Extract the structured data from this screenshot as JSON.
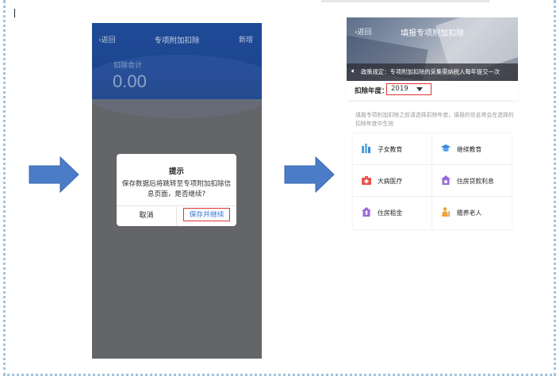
{
  "left_phone": {
    "back_label": "返回",
    "title": "专项附加扣除",
    "new_label": "新增",
    "sum_label": "扣除合计",
    "sum_value": "0.00"
  },
  "dialog": {
    "title": "提示",
    "message": "保存数据后将跳转至专项附加扣除信息页面，是否继续?",
    "cancel_label": "取消",
    "confirm_label": "保存并继续"
  },
  "right_phone": {
    "back_label": "返回",
    "title": "填报专项附加扣除",
    "notice_text": "政策规定：专项附加扣除的采集需纳税人每年提交一次",
    "year_label": "扣除年度：",
    "year_value": "2019",
    "hint": "填报专项附加扣除之前请选择扣除年度，填报的信息将会在选择的扣除年度中生效",
    "items": [
      {
        "label": "子女教育",
        "icon": "children-education-icon",
        "color": "#4a9ee0"
      },
      {
        "label": "继续教育",
        "icon": "graduation-cap-icon",
        "color": "#3b8de0"
      },
      {
        "label": "大病医疗",
        "icon": "medical-kit-icon",
        "color": "#e8564a"
      },
      {
        "label": "住房贷款利息",
        "icon": "house-loan-icon",
        "color": "#9b6ad9"
      },
      {
        "label": "住房租金",
        "icon": "house-rent-icon",
        "color": "#9b6ad9"
      },
      {
        "label": "赡养老人",
        "icon": "elderly-care-icon",
        "color": "#f2a33a"
      }
    ]
  },
  "colors": {
    "header_blue": "#1e4a96",
    "highlight_red": "#dd3333",
    "link_blue": "#3a78d6",
    "arrow_blue": "#4a7cc7"
  }
}
